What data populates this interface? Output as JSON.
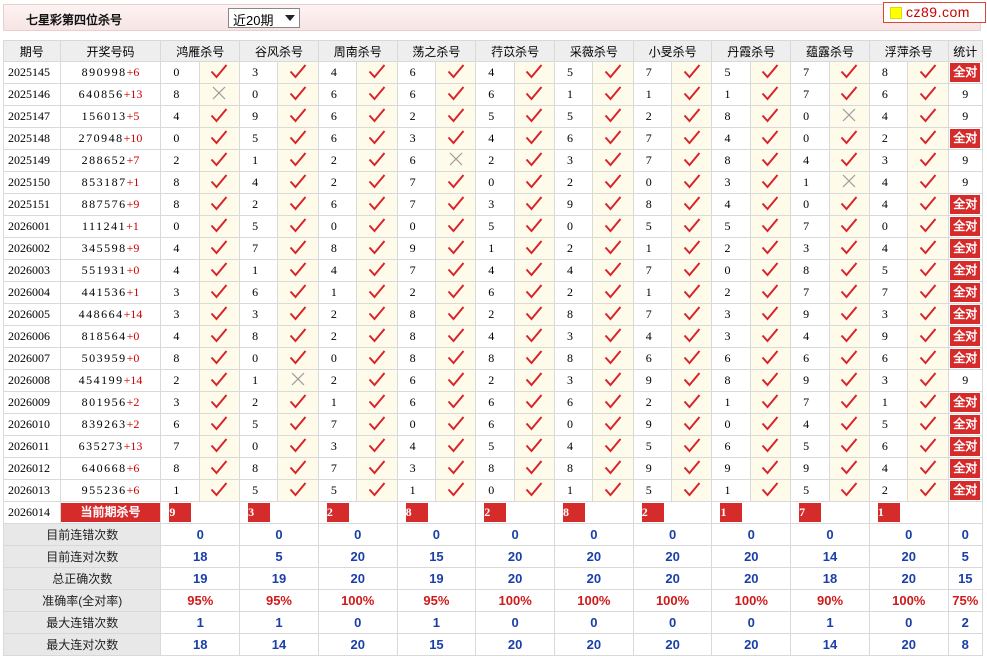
{
  "header": {
    "title": "七星彩第四位杀号",
    "range_selected": "近20期",
    "logo_text": "cz89.com"
  },
  "columns": {
    "period": "期号",
    "numbers": "开奖号码",
    "stats": "统计"
  },
  "predictors": [
    "鸿雁杀号",
    "谷风杀号",
    "周南杀号",
    "荡之杀号",
    "荇苡杀号",
    "采薇杀号",
    "小旻杀号",
    "丹霞杀号",
    "蕴露杀号",
    "浮萍杀号"
  ],
  "rows": [
    {
      "period": "2025145",
      "num": "890998",
      "add": "+6",
      "kills": [
        "0",
        "3",
        "4",
        "6",
        "4",
        "5",
        "7",
        "5",
        "7",
        "8"
      ],
      "ok": [
        1,
        1,
        1,
        1,
        1,
        1,
        1,
        1,
        1,
        1
      ],
      "stat": "全对"
    },
    {
      "period": "2025146",
      "num": "640856",
      "add": "+13",
      "kills": [
        "8",
        "0",
        "6",
        "6",
        "6",
        "1",
        "1",
        "1",
        "7",
        "6"
      ],
      "ok": [
        0,
        1,
        1,
        1,
        1,
        1,
        1,
        1,
        1,
        1
      ],
      "stat": "9"
    },
    {
      "period": "2025147",
      "num": "156013",
      "add": "+5",
      "kills": [
        "4",
        "9",
        "6",
        "2",
        "5",
        "5",
        "2",
        "8",
        "0",
        "4"
      ],
      "ok": [
        1,
        1,
        1,
        1,
        1,
        1,
        1,
        1,
        0,
        1
      ],
      "stat": "9"
    },
    {
      "period": "2025148",
      "num": "270948",
      "add": "+10",
      "kills": [
        "0",
        "5",
        "6",
        "3",
        "4",
        "6",
        "7",
        "4",
        "0",
        "2"
      ],
      "ok": [
        1,
        1,
        1,
        1,
        1,
        1,
        1,
        1,
        1,
        1
      ],
      "stat": "全对"
    },
    {
      "period": "2025149",
      "num": "288652",
      "add": "+7",
      "kills": [
        "2",
        "1",
        "2",
        "6",
        "2",
        "3",
        "7",
        "8",
        "4",
        "3"
      ],
      "ok": [
        1,
        1,
        1,
        0,
        1,
        1,
        1,
        1,
        1,
        1
      ],
      "stat": "9"
    },
    {
      "period": "2025150",
      "num": "853187",
      "add": "+1",
      "kills": [
        "8",
        "4",
        "2",
        "7",
        "0",
        "2",
        "0",
        "3",
        "1",
        "4"
      ],
      "ok": [
        1,
        1,
        1,
        1,
        1,
        1,
        1,
        1,
        0,
        1
      ],
      "stat": "9"
    },
    {
      "period": "2025151",
      "num": "887576",
      "add": "+9",
      "kills": [
        "8",
        "2",
        "6",
        "7",
        "3",
        "9",
        "8",
        "4",
        "0",
        "4"
      ],
      "ok": [
        1,
        1,
        1,
        1,
        1,
        1,
        1,
        1,
        1,
        1
      ],
      "stat": "全对"
    },
    {
      "period": "2026001",
      "num": "111241",
      "add": "+1",
      "kills": [
        "0",
        "5",
        "0",
        "0",
        "5",
        "0",
        "5",
        "5",
        "7",
        "0"
      ],
      "ok": [
        1,
        1,
        1,
        1,
        1,
        1,
        1,
        1,
        1,
        1
      ],
      "stat": "全对"
    },
    {
      "period": "2026002",
      "num": "345598",
      "add": "+9",
      "kills": [
        "4",
        "7",
        "8",
        "9",
        "1",
        "2",
        "1",
        "2",
        "3",
        "4"
      ],
      "ok": [
        1,
        1,
        1,
        1,
        1,
        1,
        1,
        1,
        1,
        1
      ],
      "stat": "全对"
    },
    {
      "period": "2026003",
      "num": "551931",
      "add": "+0",
      "kills": [
        "4",
        "1",
        "4",
        "7",
        "4",
        "4",
        "7",
        "0",
        "8",
        "5"
      ],
      "ok": [
        1,
        1,
        1,
        1,
        1,
        1,
        1,
        1,
        1,
        1
      ],
      "stat": "全对"
    },
    {
      "period": "2026004",
      "num": "441536",
      "add": "+1",
      "kills": [
        "3",
        "6",
        "1",
        "2",
        "6",
        "2",
        "1",
        "2",
        "7",
        "7"
      ],
      "ok": [
        1,
        1,
        1,
        1,
        1,
        1,
        1,
        1,
        1,
        1
      ],
      "stat": "全对"
    },
    {
      "period": "2026005",
      "num": "448664",
      "add": "+14",
      "kills": [
        "3",
        "3",
        "2",
        "8",
        "2",
        "8",
        "7",
        "3",
        "9",
        "3"
      ],
      "ok": [
        1,
        1,
        1,
        1,
        1,
        1,
        1,
        1,
        1,
        1
      ],
      "stat": "全对"
    },
    {
      "period": "2026006",
      "num": "818564",
      "add": "+0",
      "kills": [
        "4",
        "8",
        "2",
        "8",
        "4",
        "3",
        "4",
        "3",
        "4",
        "9"
      ],
      "ok": [
        1,
        1,
        1,
        1,
        1,
        1,
        1,
        1,
        1,
        1
      ],
      "stat": "全对"
    },
    {
      "period": "2026007",
      "num": "503959",
      "add": "+0",
      "kills": [
        "8",
        "0",
        "0",
        "8",
        "8",
        "8",
        "6",
        "6",
        "6",
        "6"
      ],
      "ok": [
        1,
        1,
        1,
        1,
        1,
        1,
        1,
        1,
        1,
        1
      ],
      "stat": "全对"
    },
    {
      "period": "2026008",
      "num": "454199",
      "add": "+14",
      "kills": [
        "2",
        "1",
        "2",
        "6",
        "2",
        "3",
        "9",
        "8",
        "9",
        "3"
      ],
      "ok": [
        1,
        0,
        1,
        1,
        1,
        1,
        1,
        1,
        1,
        1
      ],
      "stat": "9"
    },
    {
      "period": "2026009",
      "num": "801956",
      "add": "+2",
      "kills": [
        "3",
        "2",
        "1",
        "6",
        "6",
        "6",
        "2",
        "1",
        "7",
        "1"
      ],
      "ok": [
        1,
        1,
        1,
        1,
        1,
        1,
        1,
        1,
        1,
        1
      ],
      "stat": "全对"
    },
    {
      "period": "2026010",
      "num": "839263",
      "add": "+2",
      "kills": [
        "6",
        "5",
        "7",
        "0",
        "6",
        "0",
        "9",
        "0",
        "4",
        "5"
      ],
      "ok": [
        1,
        1,
        1,
        1,
        1,
        1,
        1,
        1,
        1,
        1
      ],
      "stat": "全对"
    },
    {
      "period": "2026011",
      "num": "635273",
      "add": "+13",
      "kills": [
        "7",
        "0",
        "3",
        "4",
        "5",
        "4",
        "5",
        "6",
        "5",
        "6"
      ],
      "ok": [
        1,
        1,
        1,
        1,
        1,
        1,
        1,
        1,
        1,
        1
      ],
      "stat": "全对"
    },
    {
      "period": "2026012",
      "num": "640668",
      "add": "+6",
      "kills": [
        "8",
        "8",
        "7",
        "3",
        "8",
        "8",
        "9",
        "9",
        "9",
        "4"
      ],
      "ok": [
        1,
        1,
        1,
        1,
        1,
        1,
        1,
        1,
        1,
        1
      ],
      "stat": "全对"
    },
    {
      "period": "2026013",
      "num": "955236",
      "add": "+6",
      "kills": [
        "1",
        "5",
        "5",
        "1",
        "0",
        "1",
        "5",
        "1",
        "5",
        "2"
      ],
      "ok": [
        1,
        1,
        1,
        1,
        1,
        1,
        1,
        1,
        1,
        1
      ],
      "stat": "全对"
    }
  ],
  "current": {
    "period": "2026014",
    "label": "当前期杀号",
    "kills": [
      "9",
      "3",
      "2",
      "8",
      "2",
      "8",
      "2",
      "1",
      "7",
      "1"
    ]
  },
  "summary": [
    {
      "label": "目前连错次数",
      "values": [
        "0",
        "0",
        "0",
        "0",
        "0",
        "0",
        "0",
        "0",
        "0",
        "0"
      ],
      "stat": "0",
      "red": false
    },
    {
      "label": "目前连对次数",
      "values": [
        "18",
        "5",
        "20",
        "15",
        "20",
        "20",
        "20",
        "20",
        "14",
        "20"
      ],
      "stat": "5",
      "red": false
    },
    {
      "label": "总正确次数",
      "values": [
        "19",
        "19",
        "20",
        "19",
        "20",
        "20",
        "20",
        "20",
        "18",
        "20"
      ],
      "stat": "15",
      "red": false
    },
    {
      "label": "准确率(全对率)",
      "values": [
        "95%",
        "95%",
        "100%",
        "95%",
        "100%",
        "100%",
        "100%",
        "100%",
        "90%",
        "100%"
      ],
      "stat": "75%",
      "red": true
    },
    {
      "label": "最大连错次数",
      "values": [
        "1",
        "1",
        "0",
        "1",
        "0",
        "0",
        "0",
        "0",
        "1",
        "0"
      ],
      "stat": "2",
      "red": false
    },
    {
      "label": "最大连对次数",
      "values": [
        "18",
        "14",
        "20",
        "15",
        "20",
        "20",
        "20",
        "20",
        "14",
        "20"
      ],
      "stat": "8",
      "red": false
    }
  ],
  "icons": {
    "correct": "check-icon",
    "wrong": "cross-icon"
  },
  "colors": {
    "check": "#d8242b",
    "cross": "#9a9a9a",
    "badge": "#d62b2b",
    "summary_value": "#1a3fa8",
    "summary_rate": "#d01a1a"
  }
}
